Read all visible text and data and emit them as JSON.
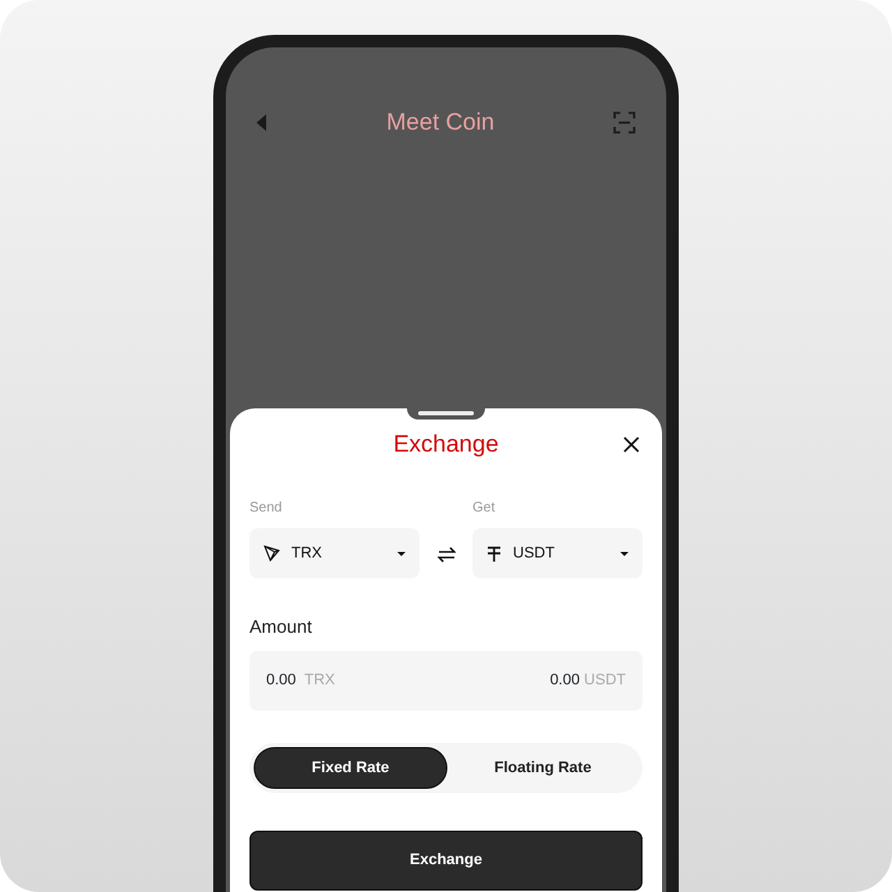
{
  "header": {
    "title": "Meet Coin"
  },
  "sheet": {
    "title": "Exchange",
    "send": {
      "label": "Send",
      "currency": "TRX"
    },
    "get": {
      "label": "Get",
      "currency": "USDT"
    },
    "amount": {
      "label": "Amount",
      "send_value": "0.00",
      "send_unit": "TRX",
      "get_value": "0.00",
      "get_unit": "USDT"
    },
    "rate_options": [
      {
        "label": "Fixed Rate",
        "selected": true
      },
      {
        "label": "Floating Rate",
        "selected": false
      }
    ],
    "submit": "Exchange"
  }
}
